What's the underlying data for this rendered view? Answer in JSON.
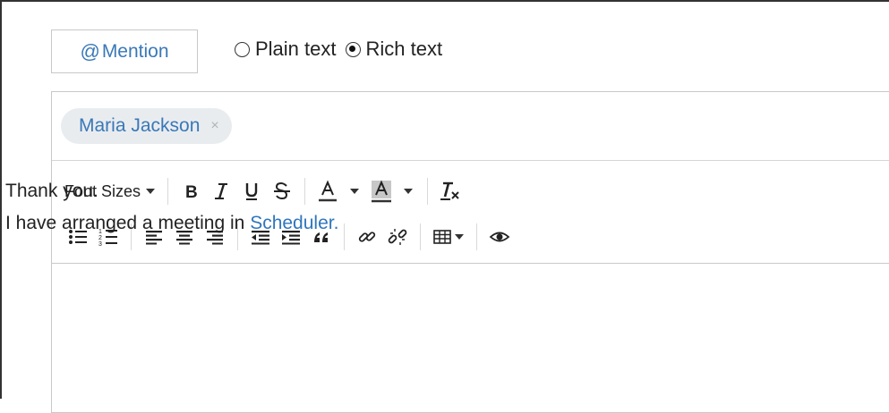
{
  "mention": {
    "at": "@",
    "label": "Mention"
  },
  "format": {
    "plain_label": "Plain text",
    "rich_label": "Rich text",
    "selected": "rich"
  },
  "recipients": [
    {
      "name": "Maria Jackson",
      "remove": "×"
    }
  ],
  "toolbar": {
    "font_sizes_label": "Font Sizes"
  },
  "body": {
    "line1": "Thank you.",
    "line2_prefix": "I have arranged a meeting in ",
    "line2_link": "Scheduler",
    "line2_suffix": "."
  },
  "colors": {
    "accent": "#3a78b8",
    "link": "#2f76bd",
    "chip_bg": "#e9ecef"
  }
}
